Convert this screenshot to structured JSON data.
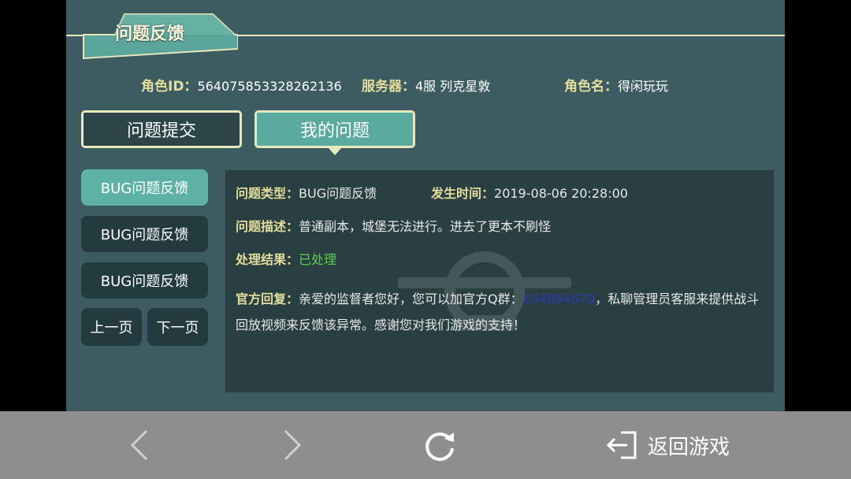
{
  "header": {
    "title": "问题反馈"
  },
  "info": {
    "role_id_label": "角色ID：",
    "role_id_value": "564075853328262136",
    "server_label": "服务器：",
    "server_value": "4服 列克星敦",
    "role_name_label": "角色名：",
    "role_name_value": "得闲玩玩"
  },
  "tabs": [
    {
      "label": "问题提交",
      "active": false
    },
    {
      "label": "我的问题",
      "active": true
    }
  ],
  "sidebar": {
    "items": [
      {
        "label": "BUG问题反馈",
        "active": true
      },
      {
        "label": "BUG问题反馈",
        "active": false
      },
      {
        "label": "BUG问题反馈",
        "active": false
      }
    ],
    "prev_label": "上一页",
    "next_label": "下一页"
  },
  "detail": {
    "type_label": "问题类型：",
    "type_value": "BUG问题反馈",
    "time_label": "发生时间：",
    "time_value": "2019-08-06 20:28:00",
    "desc_label": "问题描述：",
    "desc_value": "普通副本，城堡无法进行。进去了更本不刷怪",
    "result_label": "处理结果：",
    "result_value": "已处理",
    "reply_label": "官方回复：",
    "reply_part1": "亲爱的监督者您好，您可以加官方Q群：",
    "reply_qq": "694894679",
    "reply_part2": "，私聊管理员客服来提供战斗回放视频来反馈该异常。感谢您对我们游戏的支持！"
  },
  "bottom_nav": {
    "back_icon": "chevron-left-icon",
    "forward_icon": "chevron-right-icon",
    "refresh_icon": "refresh-icon",
    "return_icon": "exit-icon",
    "return_label": "返回游戏"
  },
  "colors": {
    "panel": "#3d5c61",
    "label_gold": "#e3dd9b",
    "active_teal": "#5eb1a5",
    "dark_button": "#233b3e",
    "result_green": "#55d14a",
    "link_blue": "#2a3bb4",
    "bottom_bar": "#8e8e8e"
  }
}
